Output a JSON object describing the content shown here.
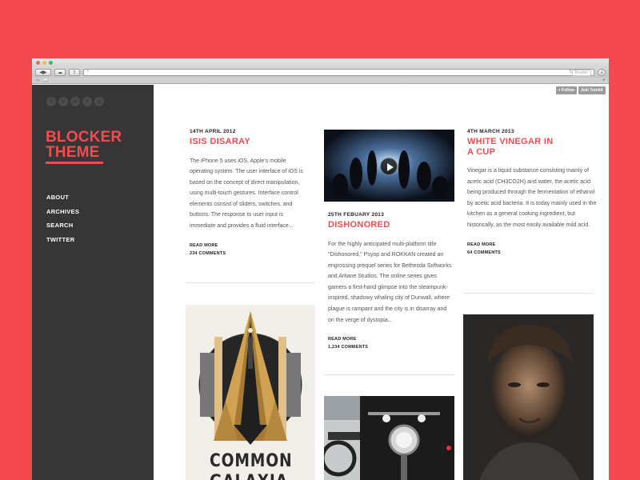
{
  "browser": {
    "address_placeholder": "",
    "reader_label": "Reader",
    "nav_back": "◀",
    "nav_forward": "▶",
    "reload_icon": "↻",
    "bookmark_add": "+"
  },
  "tumblr": {
    "follow_label": "+ Follow",
    "join_label": "Join Tumblr"
  },
  "sidebar": {
    "social_icons": [
      "twitter-icon",
      "plus-icon",
      "flickr-icon",
      "facebook-icon",
      "pinterest-icon"
    ],
    "logo_line1": "BLOCKER",
    "logo_line2": "THEME",
    "nav": [
      "ABOUT",
      "ARCHIVES",
      "SEARCH",
      "TWITTER"
    ]
  },
  "posts": [
    {
      "date": "14TH APRIL 2012",
      "title": "ISIS DISARAY",
      "body": "The iPhone 5 uses iOS, Apple's mobile operating system. The user interface of iOS is based on the concept of direct manipulation, using multi-touch gestures. Interface control elements consist of sliders, switches, and buttons. The response to user input is immediate and provides a fluid interface...",
      "read_more": "READ MORE",
      "comments": "234 COMMENTS"
    },
    {
      "date": "25TH FEBUARY 2013",
      "title": "DISHONORED",
      "body": "For the highly anticipated multi-platform title \"Dishonored,\" Psyop and ROKKAN created an engrossing prequel series for Bethesda Softworks and Arkane Studios. The online series gives gamers a first-hand glimpse into the steampunk-inspired, shadowy whaling city of Dunwall, where plague is rampant and the city is in disarray and on the verge of dystopia...",
      "read_more": "READ MORE",
      "comments": "1,234 COMMENTS"
    },
    {
      "date": "4TH MARCH 2013",
      "title_line1": "WHITE VINEGAR IN",
      "title_line2": "A CUP",
      "body": "Vinegar is a liquid substance consisting mainly of acetic acid (CH3CO2H) and water, the acetic acid being produced through the fermentation of ethanol by acetic acid bacteria. It is today mainly used in the kitchen as a general cooking ingredient, but historically, as the most easily available mild acid.",
      "read_more": "READ MORE",
      "comments": "64 COMMENTS"
    }
  ],
  "poster": {
    "title_line1": "COMMON",
    "title_line2": "GALAXIA"
  },
  "colors": {
    "background": "#f5484f",
    "accent": "#f04d50",
    "sidebar": "#363636"
  }
}
